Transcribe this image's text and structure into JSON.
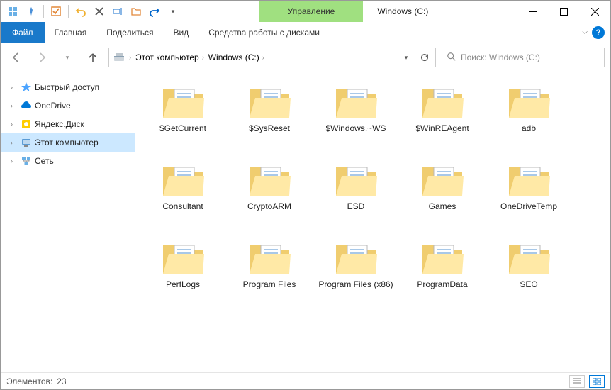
{
  "window": {
    "title": "Windows (C:)",
    "manage_tab": "Управление"
  },
  "ribbon": {
    "file": "Файл",
    "home": "Главная",
    "share": "Поделиться",
    "view": "Вид",
    "drive_tools": "Средства работы с дисками"
  },
  "breadcrumbs": {
    "root": "Этот компьютер",
    "current": "Windows (C:)"
  },
  "search": {
    "placeholder": "Поиск: Windows (C:)"
  },
  "tree": {
    "quick_access": "Быстрый доступ",
    "onedrive": "OneDrive",
    "yandex_disk": "Яндекс.Диск",
    "this_pc": "Этот компьютер",
    "network": "Сеть"
  },
  "folders": [
    {
      "name": "$GetCurrent"
    },
    {
      "name": "$SysReset"
    },
    {
      "name": "$Windows.~WS"
    },
    {
      "name": "$WinREAgent"
    },
    {
      "name": "adb"
    },
    {
      "name": "Consultant"
    },
    {
      "name": "CryptoARM"
    },
    {
      "name": "ESD"
    },
    {
      "name": "Games"
    },
    {
      "name": "OneDriveTemp"
    },
    {
      "name": "PerfLogs"
    },
    {
      "name": "Program Files"
    },
    {
      "name": "Program Files (x86)"
    },
    {
      "name": "ProgramData"
    },
    {
      "name": "SEO"
    }
  ],
  "status": {
    "count_label": "Элементов:",
    "count": "23"
  }
}
